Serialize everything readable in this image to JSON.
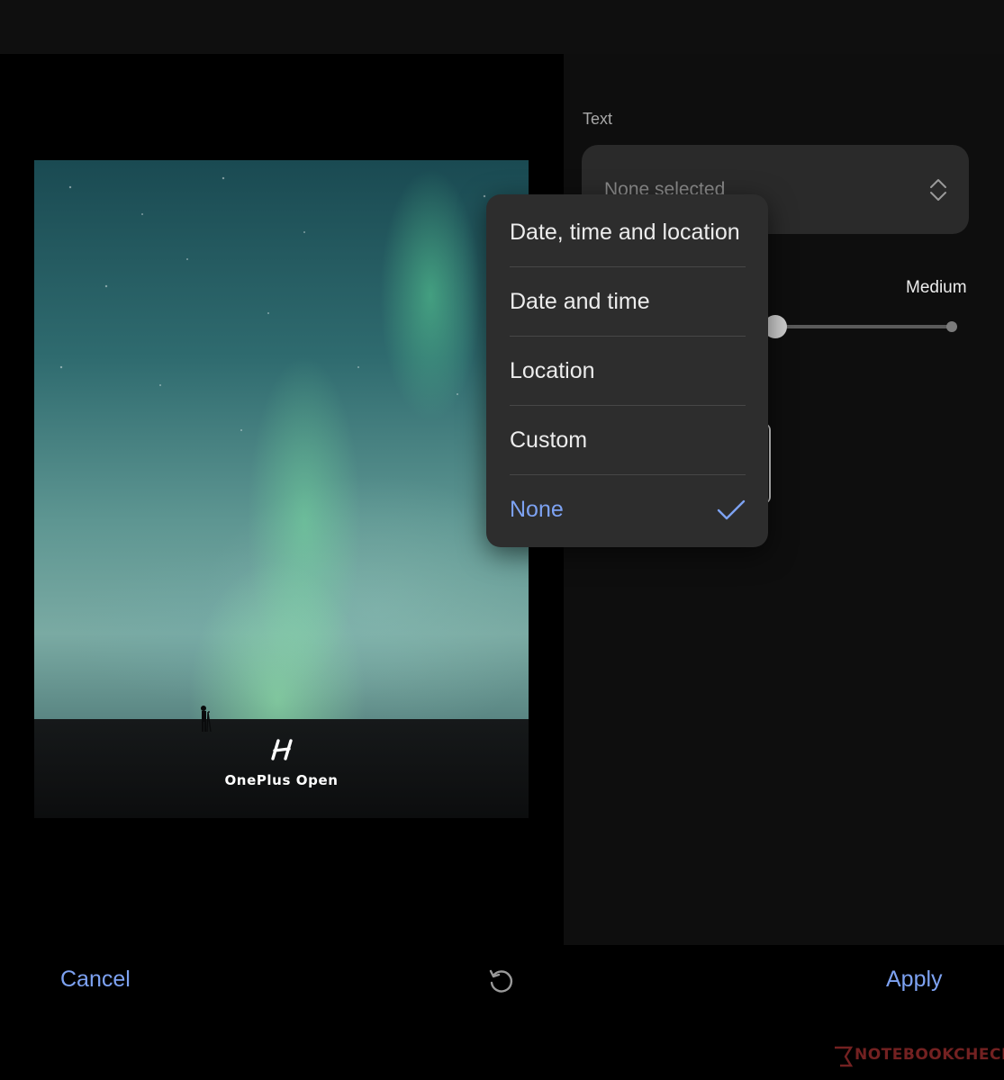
{
  "settings": {
    "text_label": "Text",
    "text_select_value": "None selected",
    "size_label": "Medium",
    "size_level": "Medium"
  },
  "dropdown": {
    "items": [
      {
        "label": "Date, time and location",
        "selected": false
      },
      {
        "label": "Date and time",
        "selected": false
      },
      {
        "label": "Location",
        "selected": false
      },
      {
        "label": "Custom",
        "selected": false
      },
      {
        "label": "None",
        "selected": true
      }
    ]
  },
  "preview": {
    "watermark_text": "OnePlus Open",
    "watermark_logo_icon": "hasselblad-h-logo-icon"
  },
  "footer": {
    "cancel_label": "Cancel",
    "apply_label": "Apply",
    "reset_icon": "reset-icon"
  },
  "site_watermark": "NOTEBOOKCHECK",
  "colors": {
    "accent": "#7da2f2",
    "menu_background": "#2d2d2d",
    "select_background": "#2a2a2a",
    "pane_background": "#0e0e0e"
  }
}
